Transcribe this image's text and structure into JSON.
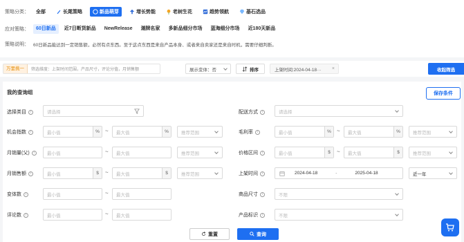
{
  "strategy": {
    "category_label": "策略分类：",
    "categories": [
      {
        "label": "全部",
        "icon": "none"
      },
      {
        "label": "长尾策略",
        "icon": "rocket-icon"
      },
      {
        "label": "新品萌芽",
        "icon": "sprout-icon",
        "active": true
      },
      {
        "label": "增长势能",
        "icon": "growth-icon"
      },
      {
        "label": "老树生花",
        "icon": "flower-icon"
      },
      {
        "label": "趋势领航",
        "icon": "trend-icon"
      },
      {
        "label": "基石选品",
        "icon": "diamond-icon"
      }
    ],
    "tactic_label": "应对策略：",
    "tactics": [
      "60日新品",
      "近7日断货新品",
      "NewRelease",
      "潮牌名家",
      "多新品细分市场",
      "蓝海细分市场",
      "近180天新品"
    ],
    "desc_label": "策略说明：",
    "desc_text": "60日新品能达到一定销售额，必然有点东西。至于这点东西是来自产品本身、或者来自卖家还是来自时机，需要仔细判断。"
  },
  "searchbar": {
    "tag": "万里挑一",
    "placeholder": "筛选维度：上架时间范围，产品尺寸，评论分值，月销售额",
    "variant_label": "展示变体：否",
    "sort_label": "排序",
    "date_chip": "上架时间:2024-04-18···",
    "collapse_label": "收起筛选"
  },
  "panel": {
    "title": "我的查询组",
    "save_label": "保存条件",
    "min_ph": "最小值",
    "max_ph": "最大值",
    "recommend_ph": "推荐范围",
    "select_ph": "请选择",
    "unlimited": "不限",
    "pct": "%",
    "dollar": "$",
    "tilde": "~",
    "left_fields": [
      "选择类目",
      "机会指数",
      "月销量(父)",
      "月销售额",
      "变体数",
      "评论数"
    ],
    "right_fields": [
      "配送方式",
      "毛利率",
      "价格区间",
      "上架时间",
      "商品尺寸",
      "产品标识"
    ],
    "date_from": "2024-04-18",
    "date_sep": "-",
    "date_to": "2025-04-18",
    "date_range": "近一年",
    "reset_label": "重置",
    "query_label": "查询"
  }
}
